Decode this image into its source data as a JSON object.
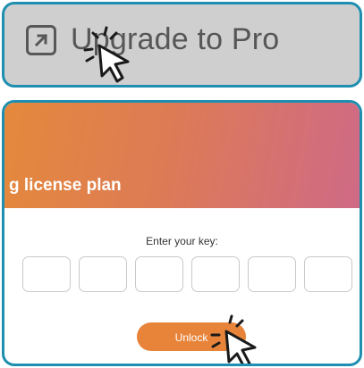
{
  "top": {
    "upgrade_label": "Upgrade to Pro",
    "icon": "external-link-arrow-icon"
  },
  "license": {
    "title": "g license plan",
    "key_label": "Enter your key:",
    "key_slots": 6,
    "unlock_label": "Unlock"
  },
  "colors": {
    "panel_border": "#1e8fb0",
    "header_gradient_start": "#e4893c",
    "header_gradient_end": "#cf6a86",
    "unlock_button": "#e8843a"
  }
}
